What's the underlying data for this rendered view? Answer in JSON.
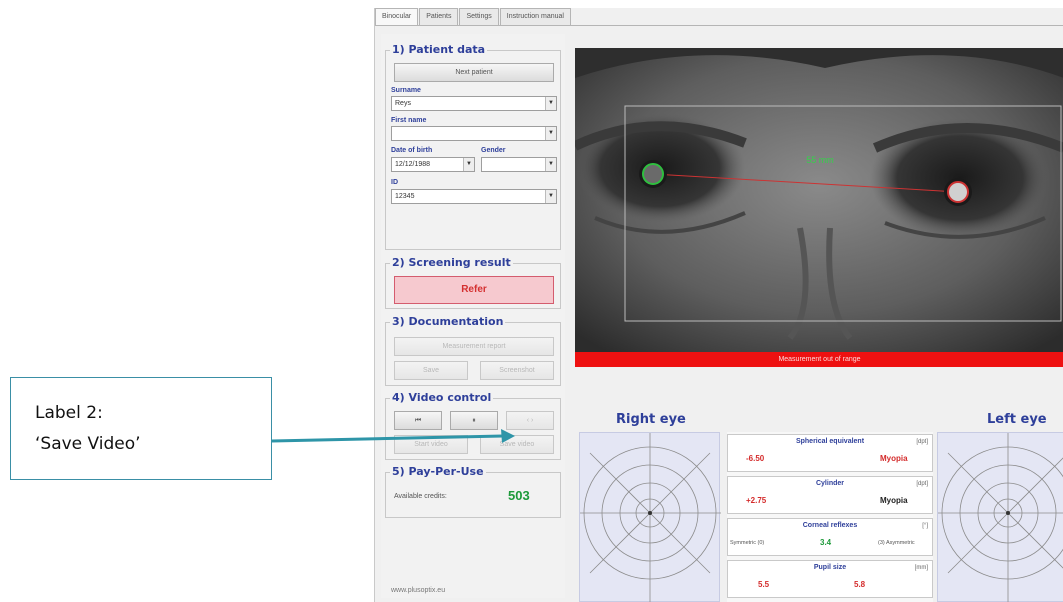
{
  "callout": {
    "line1": "Label 2:",
    "line2": "‘Save Video’"
  },
  "tabs": [
    "Binocular",
    "Patients",
    "Settings",
    "Instruction manual"
  ],
  "patient": {
    "title": "1) Patient data",
    "next_button": "Next patient",
    "surname_label": "Surname",
    "surname_value": "Reys",
    "firstname_label": "First name",
    "firstname_value": "",
    "dob_label": "Date of birth",
    "dob_value": "12/12/1988",
    "gender_label": "Gender",
    "gender_value": "",
    "id_label": "ID",
    "id_value": "12345"
  },
  "screening": {
    "title": "2) Screening result",
    "result": "Refer"
  },
  "documentation": {
    "title": "3) Documentation",
    "report_button": "Measurement report",
    "save_button": "Save",
    "screenshot_button": "Screenshot"
  },
  "video_control": {
    "title": "4) Video control",
    "record_button": "Start video",
    "save_button": "Save video"
  },
  "payperuse": {
    "title": "5) Pay-Per-Use",
    "credits_label": "Available credits:",
    "credits_value": "503"
  },
  "footer": {
    "url": "www.plusoptix.eu"
  },
  "video": {
    "distance": "55 mm",
    "status": "Measurement out of range"
  },
  "right_eye": {
    "heading": "Right eye"
  },
  "left_eye": {
    "heading": "Left eye"
  },
  "results": {
    "spherical": {
      "title": "Spherical equivalent",
      "unit": "[dpt]",
      "right": "-6.50",
      "right_label": "Myopia"
    },
    "cylinder": {
      "title": "Cylinder",
      "unit": "[dpt]",
      "right": "+2.75",
      "right_label": "Myopia"
    },
    "corneal": {
      "title": "Corneal reflexes",
      "unit": "[°]",
      "left_label": "Symmetric (0)",
      "value": "3.4",
      "right_label": "(3) Asymmetric"
    },
    "pupil": {
      "title": "Pupil size",
      "unit": "[mm]",
      "right": "5.5",
      "left": "5.8"
    }
  },
  "colors": {
    "accent": "#2e3f9a",
    "status_red": "#ee1111",
    "credits_green": "#1d9a3a",
    "callout_border": "#3a8fa6"
  }
}
